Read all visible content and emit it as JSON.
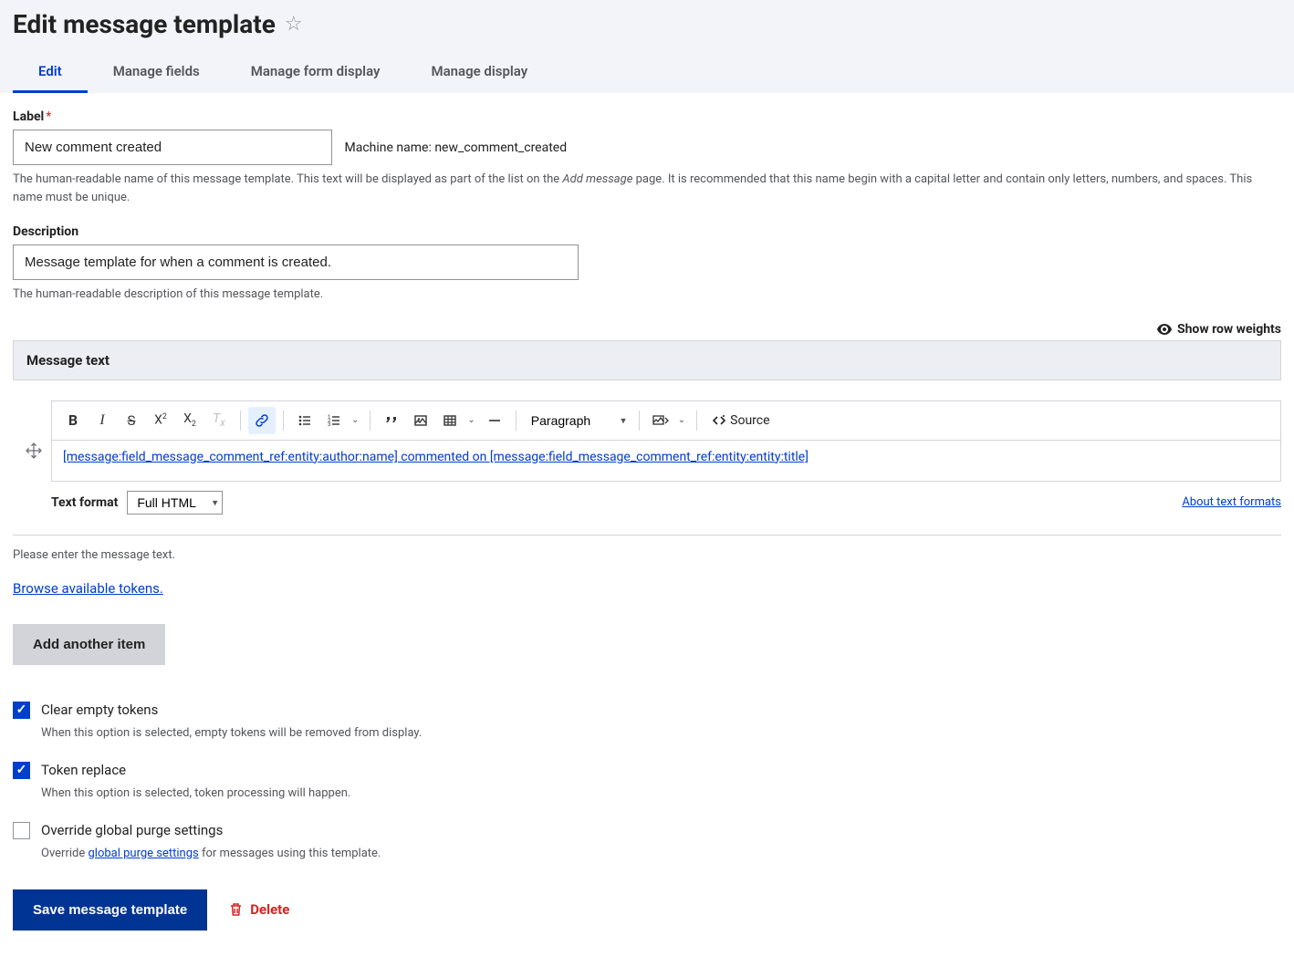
{
  "header": {
    "title": "Edit message template"
  },
  "tabs": [
    {
      "label": "Edit"
    },
    {
      "label": "Manage fields"
    },
    {
      "label": "Manage form display"
    },
    {
      "label": "Manage display"
    }
  ],
  "label_field": {
    "label": "Label",
    "value": "New comment created",
    "machine_name_label": "Machine name:",
    "machine_name_value": "new_comment_created",
    "help_pre": "The human-readable name of this message template. This text will be displayed as part of the list on the ",
    "help_em": "Add message",
    "help_post": " page. It is recommended that this name begin with a capital letter and contain only letters, numbers, and spaces. This name must be unique."
  },
  "description_field": {
    "label": "Description",
    "value": "Message template for when a comment is created.",
    "help": "The human-readable description of this message template."
  },
  "row_weights": "Show row weights",
  "message_text": {
    "section_label": "Message text",
    "paragraph_select": "Paragraph",
    "source_label": "Source",
    "body_html": "[message:field_message_comment_ref:entity:author:name] commented on [message:field_message_comment_ref:entity:entity:title]",
    "text_format_label": "Text format",
    "text_format_value": "Full HTML",
    "about_link": "About text formats",
    "below_help": "Please enter the message text.",
    "tokens_link": "Browse available tokens.",
    "add_item_label": "Add another item"
  },
  "checkboxes": {
    "clear_tokens": {
      "label": "Clear empty tokens",
      "help": "When this option is selected, empty tokens will be removed from display.",
      "checked": true
    },
    "token_replace": {
      "label": "Token replace",
      "help": "When this option is selected, token processing will happen.",
      "checked": true
    },
    "override_purge": {
      "label": "Override global purge settings",
      "help_pre": "Override ",
      "help_link": "global purge settings",
      "help_post": " for messages using this template.",
      "checked": false
    }
  },
  "actions": {
    "save": "Save message template",
    "delete": "Delete"
  }
}
